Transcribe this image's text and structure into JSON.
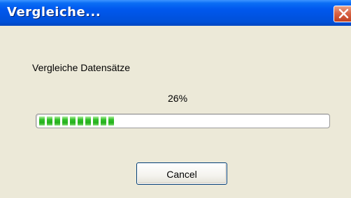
{
  "window": {
    "title": "Vergleiche..."
  },
  "icons": {
    "close": "close-icon"
  },
  "dialog": {
    "message": "Vergleiche Datensätze",
    "progress_text": "26%",
    "progress_value": 26,
    "cancel_label": "Cancel"
  },
  "colors": {
    "titlebar": "#0054e3",
    "dialog_background": "#ece9d8",
    "progress_green": "#31c128",
    "close_button": "#d86445"
  }
}
